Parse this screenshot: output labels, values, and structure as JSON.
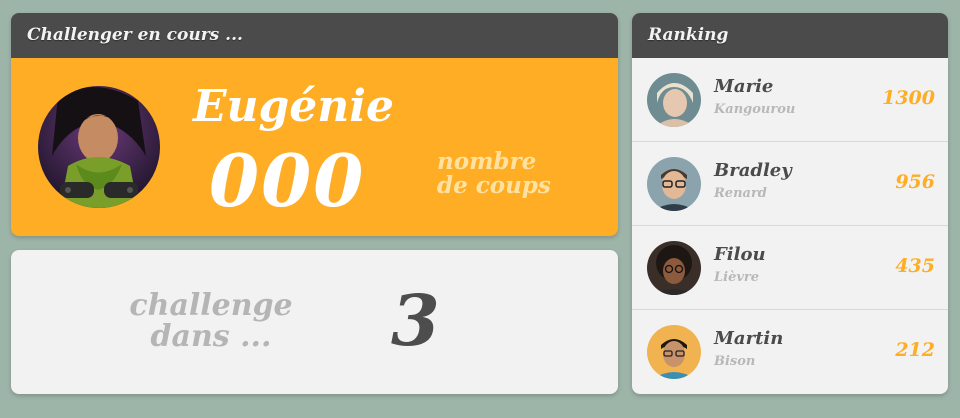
{
  "colors": {
    "background": "#9db4a8",
    "header": "#4b4b4b",
    "accent": "#ffad24",
    "card": "#f2f2f2"
  },
  "challenger": {
    "header": "Challenger en cours ...",
    "name": "Eugénie",
    "score": "000",
    "score_label_line1": "nombre",
    "score_label_line2": "de coups",
    "avatar": "player-photo-eugenie"
  },
  "countdown": {
    "label_line1": "challenge",
    "label_line2": "dans ...",
    "value": "3"
  },
  "ranking": {
    "header": "Ranking",
    "players": [
      {
        "name": "Marie",
        "animal": "Kangourou",
        "score": "1300",
        "avatar": "player-photo-marie"
      },
      {
        "name": "Bradley",
        "animal": "Renard",
        "score": "956",
        "avatar": "player-photo-bradley"
      },
      {
        "name": "Filou",
        "animal": "Lièvre",
        "score": "435",
        "avatar": "player-photo-filou"
      },
      {
        "name": "Martin",
        "animal": "Bison",
        "score": "212",
        "avatar": "player-photo-martin"
      }
    ]
  }
}
